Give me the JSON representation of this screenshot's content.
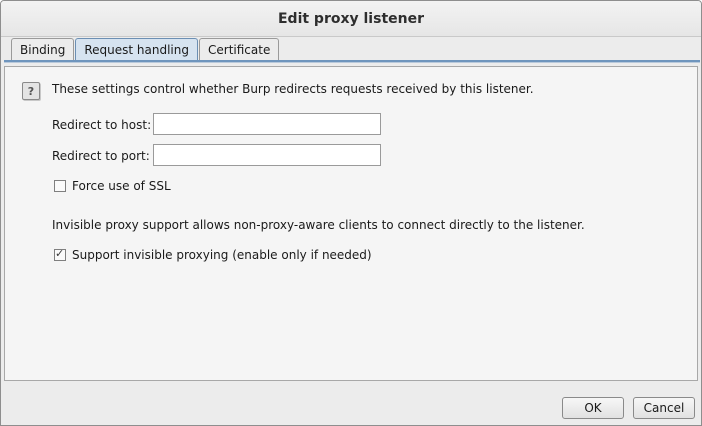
{
  "dialog": {
    "title": "Edit proxy listener"
  },
  "tabs": [
    {
      "label": "Binding",
      "active": false
    },
    {
      "label": "Request handling",
      "active": true
    },
    {
      "label": "Certificate",
      "active": false
    }
  ],
  "request_handling": {
    "help_icon": "question-mark-icon",
    "description": "These settings control whether Burp redirects requests received by this listener.",
    "redirect_host": {
      "label": "Redirect to host:",
      "value": ""
    },
    "redirect_port": {
      "label": "Redirect to port:",
      "value": ""
    },
    "force_ssl": {
      "label": "Force use of SSL",
      "checked": false
    },
    "invisible_description": "Invisible proxy support allows non-proxy-aware clients to connect directly to the listener.",
    "invisible_proxying": {
      "label": "Support invisible proxying (enable only if needed)",
      "checked": true
    }
  },
  "buttons": {
    "ok": "OK",
    "cancel": "Cancel"
  },
  "colors": {
    "active_tab": "#d6e3f0",
    "tab_underline": "#6f95bd"
  }
}
